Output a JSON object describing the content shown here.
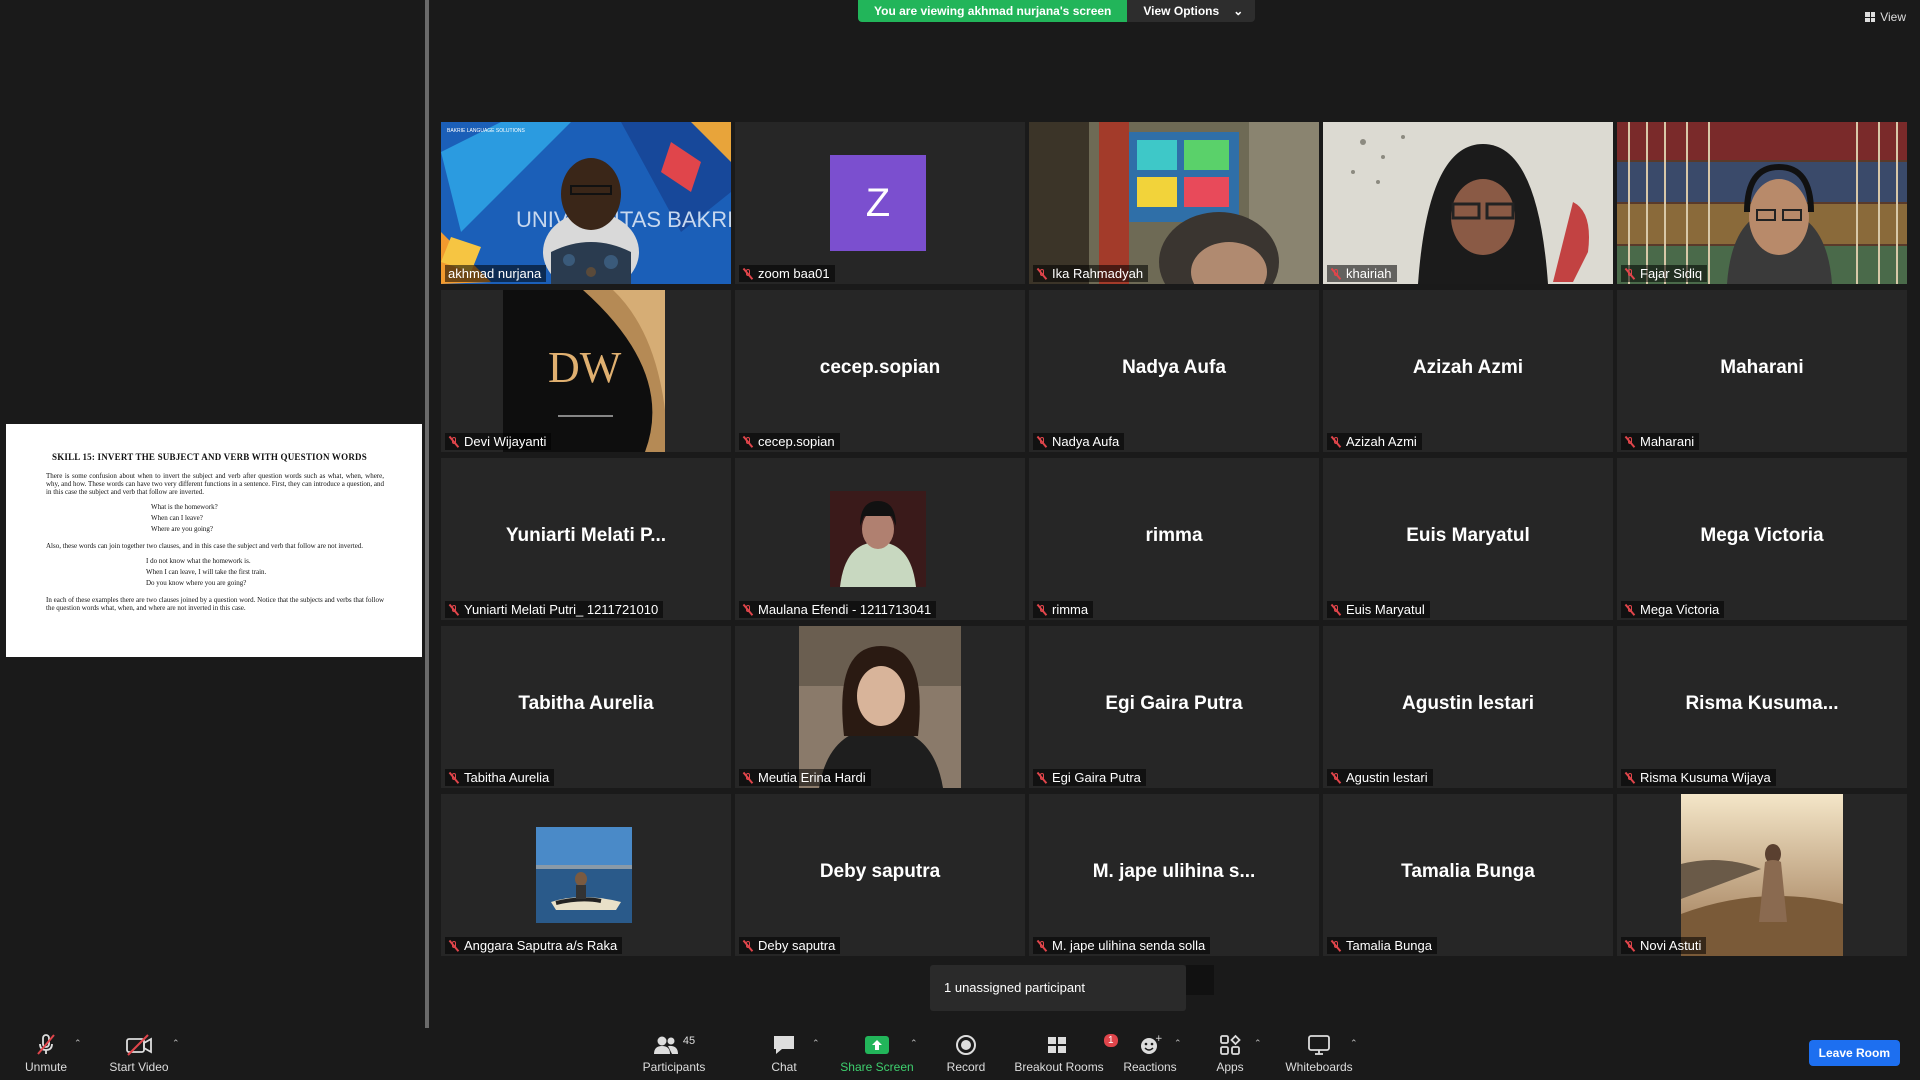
{
  "banner": {
    "message": "You are viewing akhmad nurjana's screen",
    "view_options": "View Options"
  },
  "view_button": "View",
  "shared_document": {
    "title": "SKILL 15:   INVERT THE SUBJECT AND VERB WITH QUESTION WORDS",
    "para1": "There is some confusion about when to invert the subject and verb after question words such as what, when, where, why, and how. These words can have two very different functions in a sentence. First, they can introduce a question, and in this case the subject and verb that follow are inverted.",
    "examples1": [
      "What is the homework?",
      "When can I leave?",
      "Where are you going?"
    ],
    "para2": "Also, these words can join together two clauses, and in this case the subject and verb that follow are not inverted.",
    "examples2": [
      "I do not know what the homework is.",
      "When I can leave, I will take the first train.",
      "Do you know where you are going?"
    ],
    "para3": "In each of these examples there are two clauses joined by a question word. Notice that the subjects and verbs that follow the question words what, when, and where are not inverted in this case."
  },
  "participants": [
    {
      "label": "akhmad nurjana",
      "display": "",
      "type": "video-presenter"
    },
    {
      "label": "zoom baa01",
      "display": "Z",
      "type": "avatar"
    },
    {
      "label": "Ika Rahmadyah",
      "display": "",
      "type": "video-room"
    },
    {
      "label": "khairiah",
      "display": "",
      "type": "video-wall"
    },
    {
      "label": "Fajar Sidiq",
      "display": "",
      "type": "video-books"
    },
    {
      "label": "Devi Wijayanti",
      "display": "",
      "type": "logo-dw"
    },
    {
      "label": "cecep.sopian",
      "display": "cecep.sopian",
      "type": "name"
    },
    {
      "label": "Nadya Aufa",
      "display": "Nadya Aufa",
      "type": "name"
    },
    {
      "label": "Azizah Azmi",
      "display": "Azizah Azmi",
      "type": "name"
    },
    {
      "label": "Maharani",
      "display": "Maharani",
      "type": "name"
    },
    {
      "label": "Yuniarti Melati Putri_ 1211721010",
      "display": "Yuniarti Melati P...",
      "type": "name"
    },
    {
      "label": "Maulana Efendi - 1211713041",
      "display": "",
      "type": "photo-dark"
    },
    {
      "label": "rimma",
      "display": "rimma",
      "type": "name"
    },
    {
      "label": "Euis Maryatul",
      "display": "Euis Maryatul",
      "type": "name"
    },
    {
      "label": "Mega Victoria",
      "display": "Mega Victoria",
      "type": "name"
    },
    {
      "label": "Tabitha Aurelia",
      "display": "Tabitha Aurelia",
      "type": "name"
    },
    {
      "label": "Meutia Erina Hardi",
      "display": "",
      "type": "photo-girl"
    },
    {
      "label": "Egi Gaira Putra",
      "display": "Egi Gaira Putra",
      "type": "name"
    },
    {
      "label": "Agustin lestari",
      "display": "Agustin lestari",
      "type": "name"
    },
    {
      "label": "Risma Kusuma Wijaya",
      "display": "Risma  Kusuma...",
      "type": "name"
    },
    {
      "label": "Anggara Saputra a/s Raka",
      "display": "",
      "type": "photo-jetski"
    },
    {
      "label": "Deby saputra",
      "display": "Deby saputra",
      "type": "name"
    },
    {
      "label": "M. jape ulihina senda solla",
      "display": "M. jape ulihina s...",
      "type": "name"
    },
    {
      "label": "Tamalia Bunga",
      "display": "Tamalia Bunga",
      "type": "name"
    },
    {
      "label": "Novi Astuti",
      "display": "",
      "type": "photo-sunset"
    }
  ],
  "presenter_bg_text": "UNIVERSITAS BAKRIE",
  "presenter_logo_text": "BAKRIE LANGUAGE SOLUTIONS",
  "dw_logo": "DW",
  "unassigned": "1 unassigned participant",
  "toolbar": {
    "unmute": "Unmute",
    "start_video": "Start Video",
    "participants": "Participants",
    "participants_count": "45",
    "chat": "Chat",
    "share_screen": "Share Screen",
    "record": "Record",
    "breakout_rooms": "Breakout Rooms",
    "breakout_badge": "1",
    "reactions": "Reactions",
    "apps": "Apps",
    "whiteboards": "Whiteboards",
    "leave_room": "Leave Room"
  },
  "colors": {
    "accent_green": "#22b55a",
    "active_speaker": "#f6e34a",
    "leave_blue": "#1d6ff0",
    "muted_red": "#e0454b"
  }
}
